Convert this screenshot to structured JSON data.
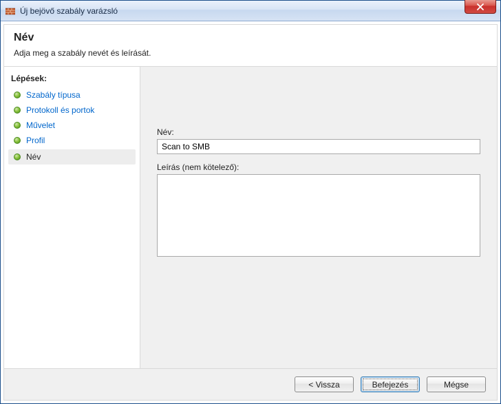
{
  "window": {
    "title": "Új bejövő szabály varázsló"
  },
  "header": {
    "title": "Név",
    "subtitle": "Adja meg a szabály nevét és leírását."
  },
  "sidebar": {
    "heading": "Lépések:",
    "items": [
      {
        "label": "Szabály típusa"
      },
      {
        "label": "Protokoll és portok"
      },
      {
        "label": "Művelet"
      },
      {
        "label": "Profil"
      },
      {
        "label": "Név"
      }
    ]
  },
  "form": {
    "name_label": "Név:",
    "name_value": "Scan to SMB",
    "desc_label": "Leírás (nem kötelező):",
    "desc_value": ""
  },
  "buttons": {
    "back": "< Vissza",
    "finish": "Befejezés",
    "cancel": "Mégse"
  }
}
